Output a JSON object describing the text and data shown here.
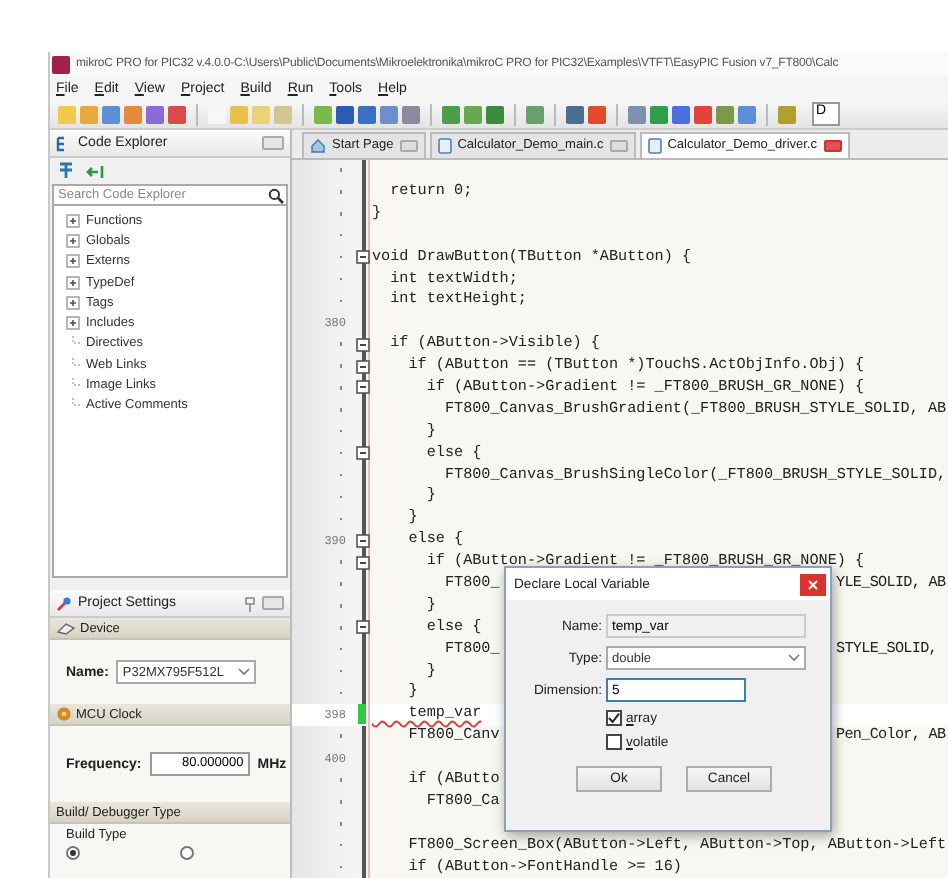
{
  "window": {
    "title": "mikroC PRO for PIC32 v.4.0.0-C:\\Users\\Public\\Documents\\Mikroelektronika\\mikroC PRO for PIC32\\Examples\\VTFT\\EasyPIC Fusion v7_FT800\\Calc"
  },
  "menu": [
    "File",
    "Edit",
    "View",
    "Project",
    "Build",
    "Run",
    "Tools",
    "Help"
  ],
  "toolbar": {
    "combo_value": "D"
  },
  "code_explorer": {
    "title": "Code Explorer",
    "search": {
      "placeholder": "Search Code Explorer"
    },
    "items": [
      {
        "label": "Functions",
        "kind": "group",
        "expanded": false
      },
      {
        "label": "Globals",
        "kind": "group",
        "expanded": false
      },
      {
        "label": "Externs",
        "kind": "group",
        "expanded": false
      },
      {
        "label": "TypeDef",
        "kind": "group",
        "expanded": false
      },
      {
        "label": "Tags",
        "kind": "group",
        "expanded": false
      },
      {
        "label": "Includes",
        "kind": "group",
        "expanded": false
      },
      {
        "label": "Directives",
        "kind": "leaf"
      },
      {
        "label": "Web Links",
        "kind": "leaf"
      },
      {
        "label": "Image Links",
        "kind": "leaf"
      },
      {
        "label": "Active Comments",
        "kind": "leaf"
      }
    ]
  },
  "project_settings": {
    "title": "Project Settings",
    "device": {
      "title": "Device",
      "label": "Name:",
      "value": "P32MX795F512L"
    },
    "clock": {
      "title": "MCU Clock",
      "label": "Frequency:",
      "value": "80.000000",
      "unit": "MHz"
    },
    "build": {
      "title": "Build/ Debugger Type",
      "label": "Build Type",
      "radios": [
        {
          "selected": true
        },
        {
          "selected": false
        }
      ]
    }
  },
  "tabs": [
    {
      "label": "Start Page",
      "kind": "home",
      "selected": false
    },
    {
      "label": "Calculator_Demo_main.c",
      "kind": "file",
      "selected": false
    },
    {
      "label": "Calculator_Demo_driver.c",
      "kind": "file",
      "selected": true
    }
  ],
  "code": [
    {
      "dot": true
    },
    {
      "text": "  return 0;",
      "dot": true
    },
    {
      "text": "}",
      "dot": true
    },
    {
      "dot": true
    },
    {
      "text": "void DrawButton(TButton *AButton) {",
      "dot": true,
      "fold": true
    },
    {
      "text": "  int textWidth;",
      "dot": true
    },
    {
      "text": "  int textHeight;",
      "dot": true
    },
    {
      "number": "380"
    },
    {
      "text": "  if (AButton->Visible) {",
      "dot": true,
      "fold": true
    },
    {
      "text": "    if (AButton == (TButton *)TouchS.ActObjInfo.Obj) {",
      "dot": true,
      "fold": true
    },
    {
      "text": "      if (AButton->Gradient != _FT800_BRUSH_GR_NONE) {",
      "dot": true,
      "fold": true
    },
    {
      "text": "        FT800_Canvas_BrushGradient(_FT800_BRUSH_STYLE_SOLID, AB",
      "dot": true
    },
    {
      "text": "      }",
      "dot": true
    },
    {
      "text": "      else {",
      "dot": true,
      "fold": true
    },
    {
      "text": "        FT800_Canvas_BrushSingleColor(_FT800_BRUSH_STYLE_SOLID,",
      "dot": true
    },
    {
      "text": "      }",
      "dot": true
    },
    {
      "text": "    }",
      "dot": true
    },
    {
      "text": "    else {",
      "number": "390",
      "fold": true
    },
    {
      "text": "      if (AButton->Gradient != _FT800_BRUSH_GR_NONE) {",
      "dot": true,
      "fold": true
    },
    {
      "text": "        FT800_",
      "tail": "YLE_SOLID, AB",
      "dot": true
    },
    {
      "text": "      }",
      "dot": true
    },
    {
      "text": "      else {",
      "dot": true,
      "fold": true
    },
    {
      "text": "        FT800_",
      "tail": "STYLE_SOLID,",
      "dot": true
    },
    {
      "text": "      }",
      "dot": true
    },
    {
      "text": "    }",
      "dot": true
    },
    {
      "text": "    temp_var",
      "number": "398",
      "current": true,
      "error": true
    },
    {
      "text": "    FT800_Canv",
      "tail": "Pen_Color, AB",
      "dot": true
    },
    {
      "number": "400"
    },
    {
      "text": "    if (AButto",
      "dot": true
    },
    {
      "text": "      FT800_Ca",
      "dot": true
    },
    {
      "dot": true
    },
    {
      "text": "    FT800_Screen_Box(AButton->Left, AButton->Top, AButton->Left",
      "dot": true
    },
    {
      "text": "    if (AButton->FontHandle >= 16)",
      "dot": true
    }
  ],
  "dialog": {
    "title": "Declare Local Variable",
    "name": {
      "label": "Name:",
      "value": "temp_var"
    },
    "type": {
      "label": "Type:",
      "value": "double"
    },
    "dimension": {
      "label": "Dimension:",
      "value": "5"
    },
    "checks": [
      {
        "label": "array",
        "checked": true
      },
      {
        "label": "volatile",
        "checked": false
      }
    ],
    "buttons": [
      "Ok",
      "Cancel"
    ]
  }
}
